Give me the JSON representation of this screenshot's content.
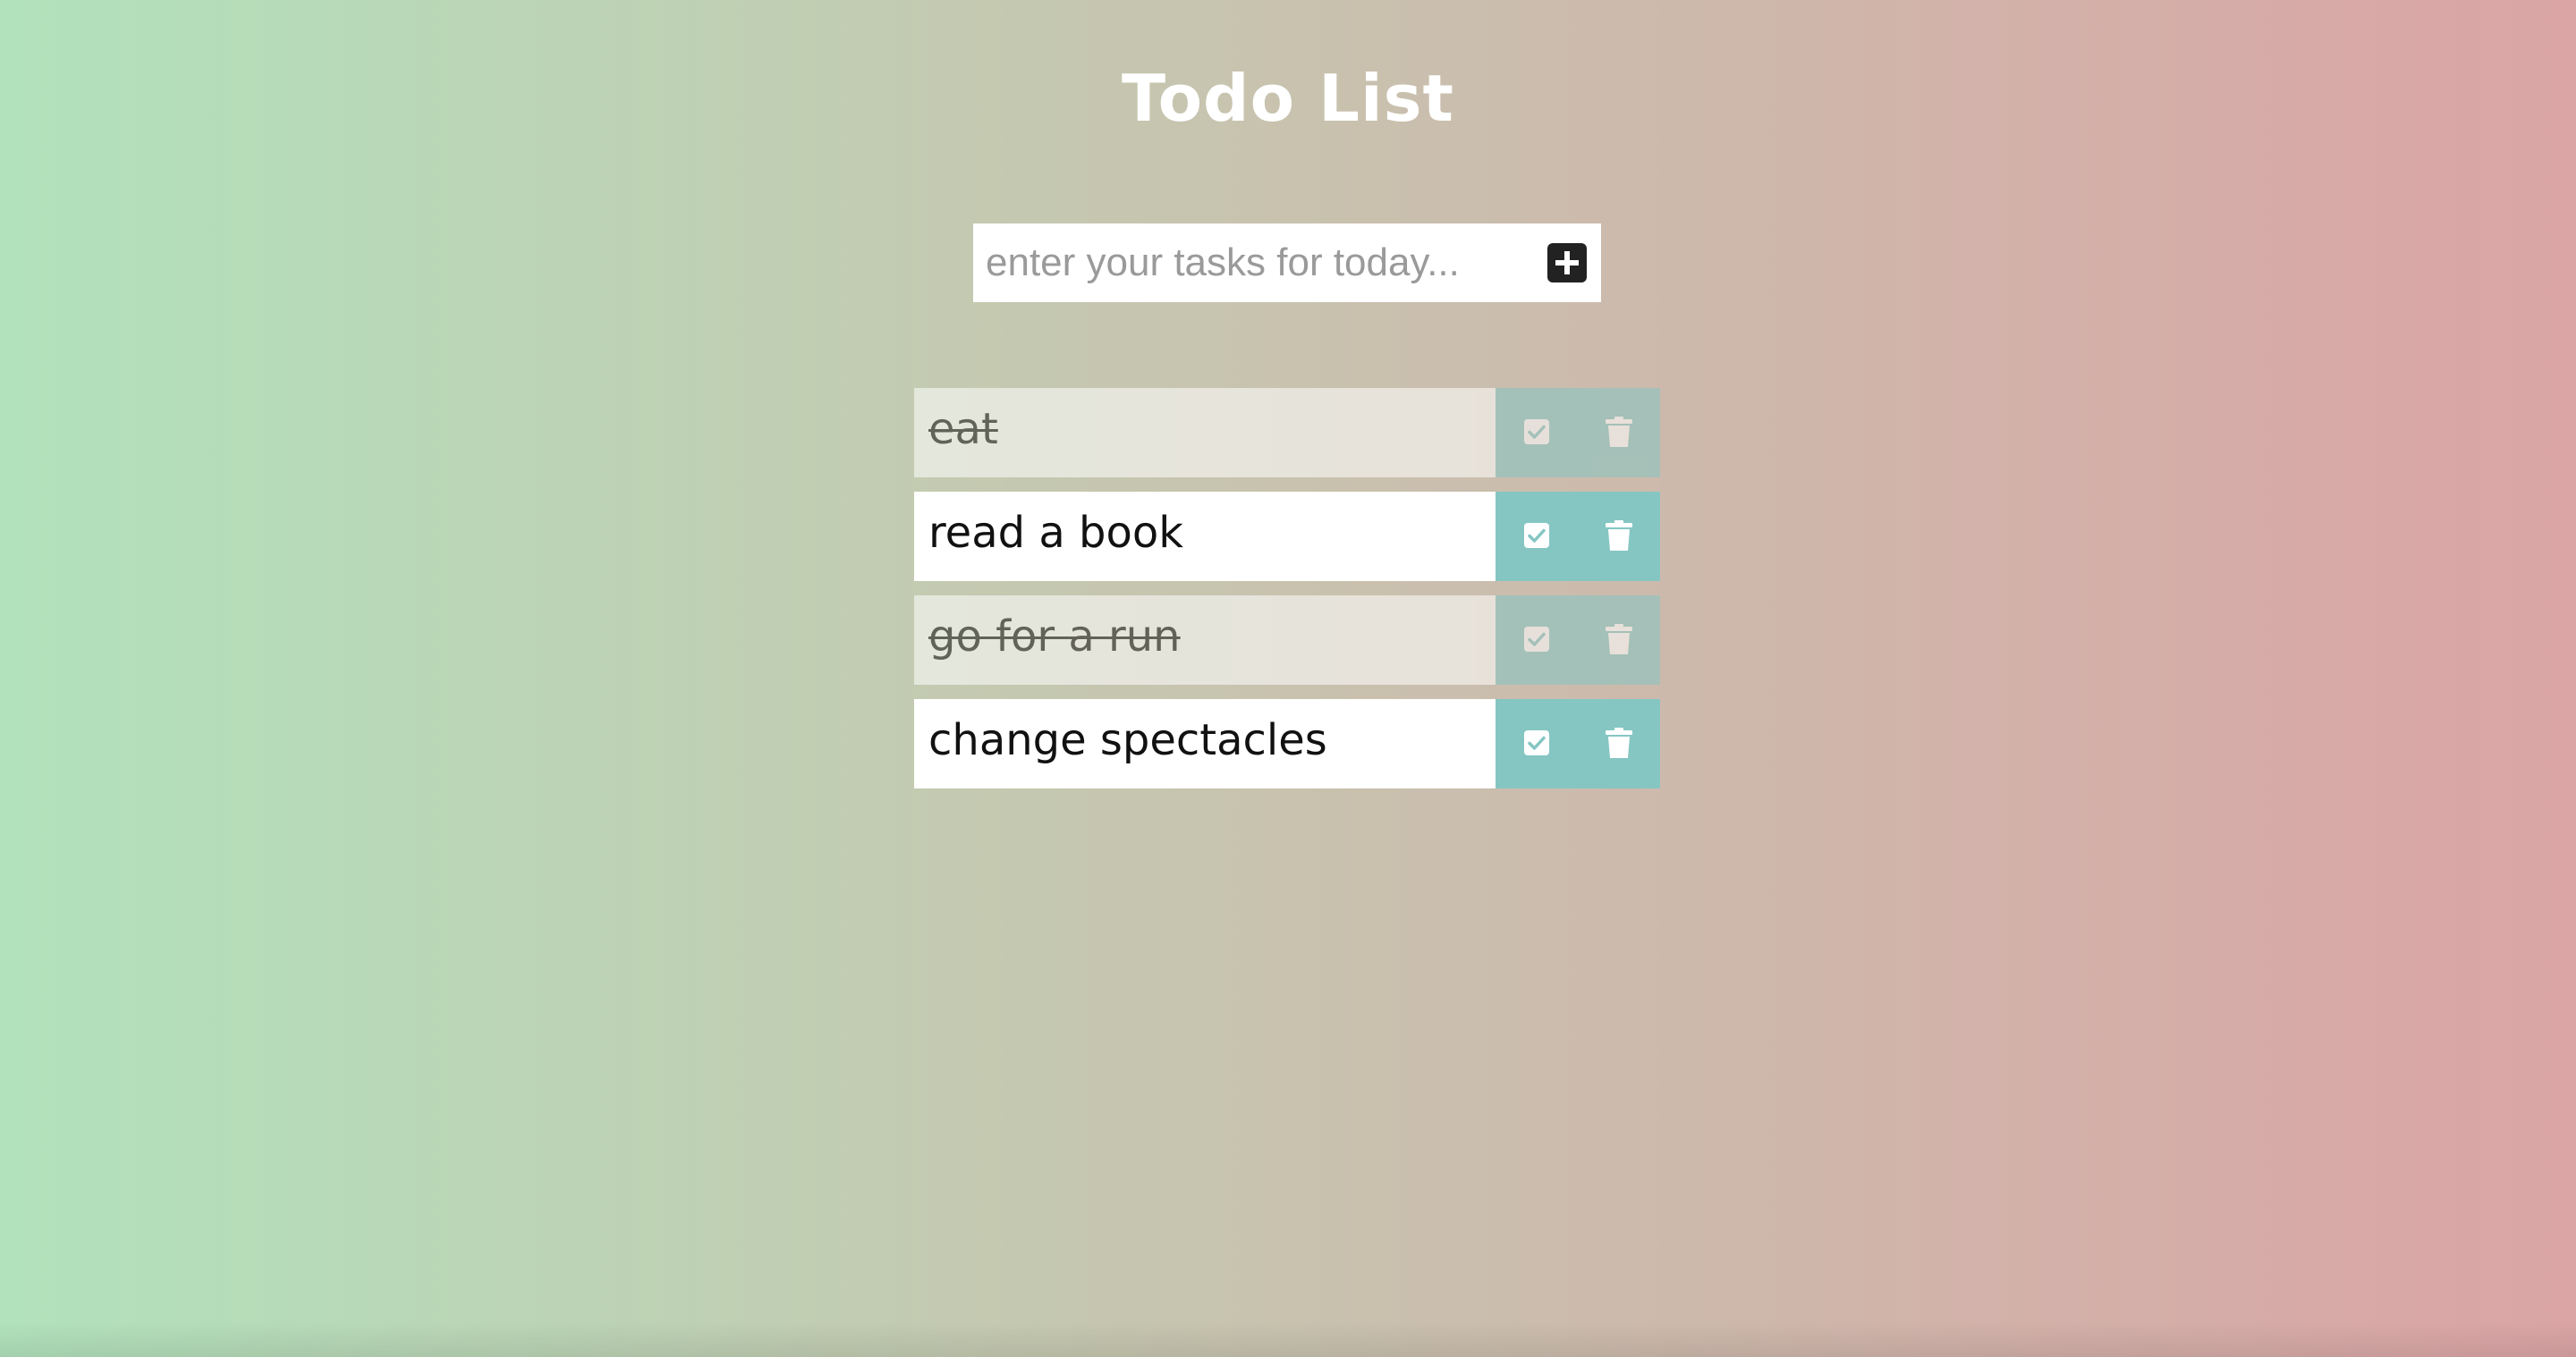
{
  "page": {
    "title": "Todo List"
  },
  "form": {
    "input_value": "",
    "placeholder": "enter your tasks for today...",
    "add_icon": "plus-square-icon"
  },
  "todos": [
    {
      "text": "eat",
      "completed": true
    },
    {
      "text": "read a book",
      "completed": false
    },
    {
      "text": "go for a run",
      "completed": true
    },
    {
      "text": "change spectacles",
      "completed": false
    }
  ],
  "icons": {
    "complete": "check-square-icon",
    "delete": "trash-icon"
  },
  "colors": {
    "gradient_left": "#b1e2bb",
    "gradient_right": "#dba4a5",
    "action_accent": "#85c6c3",
    "title_text": "#ffffff"
  }
}
